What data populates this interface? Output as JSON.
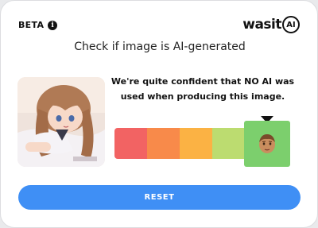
{
  "header": {
    "badge_label": "BETA",
    "info_icon": "info-icon",
    "logo_text": "wasit",
    "logo_badge": "AI"
  },
  "main": {
    "headline": "Check if image is AI-generated",
    "result_text": "We're quite confident that NO AI was used when producing this image.",
    "thumbnail": "anime-style-illustration-thumbnail"
  },
  "meter": {
    "segments": [
      "#f26363",
      "#f88a4a",
      "#fbb244",
      "#bcdc70",
      "#7ccf6d"
    ],
    "active_index": 4,
    "active_icon": "human-face-emoji"
  },
  "actions": {
    "reset_label": "RESET"
  }
}
